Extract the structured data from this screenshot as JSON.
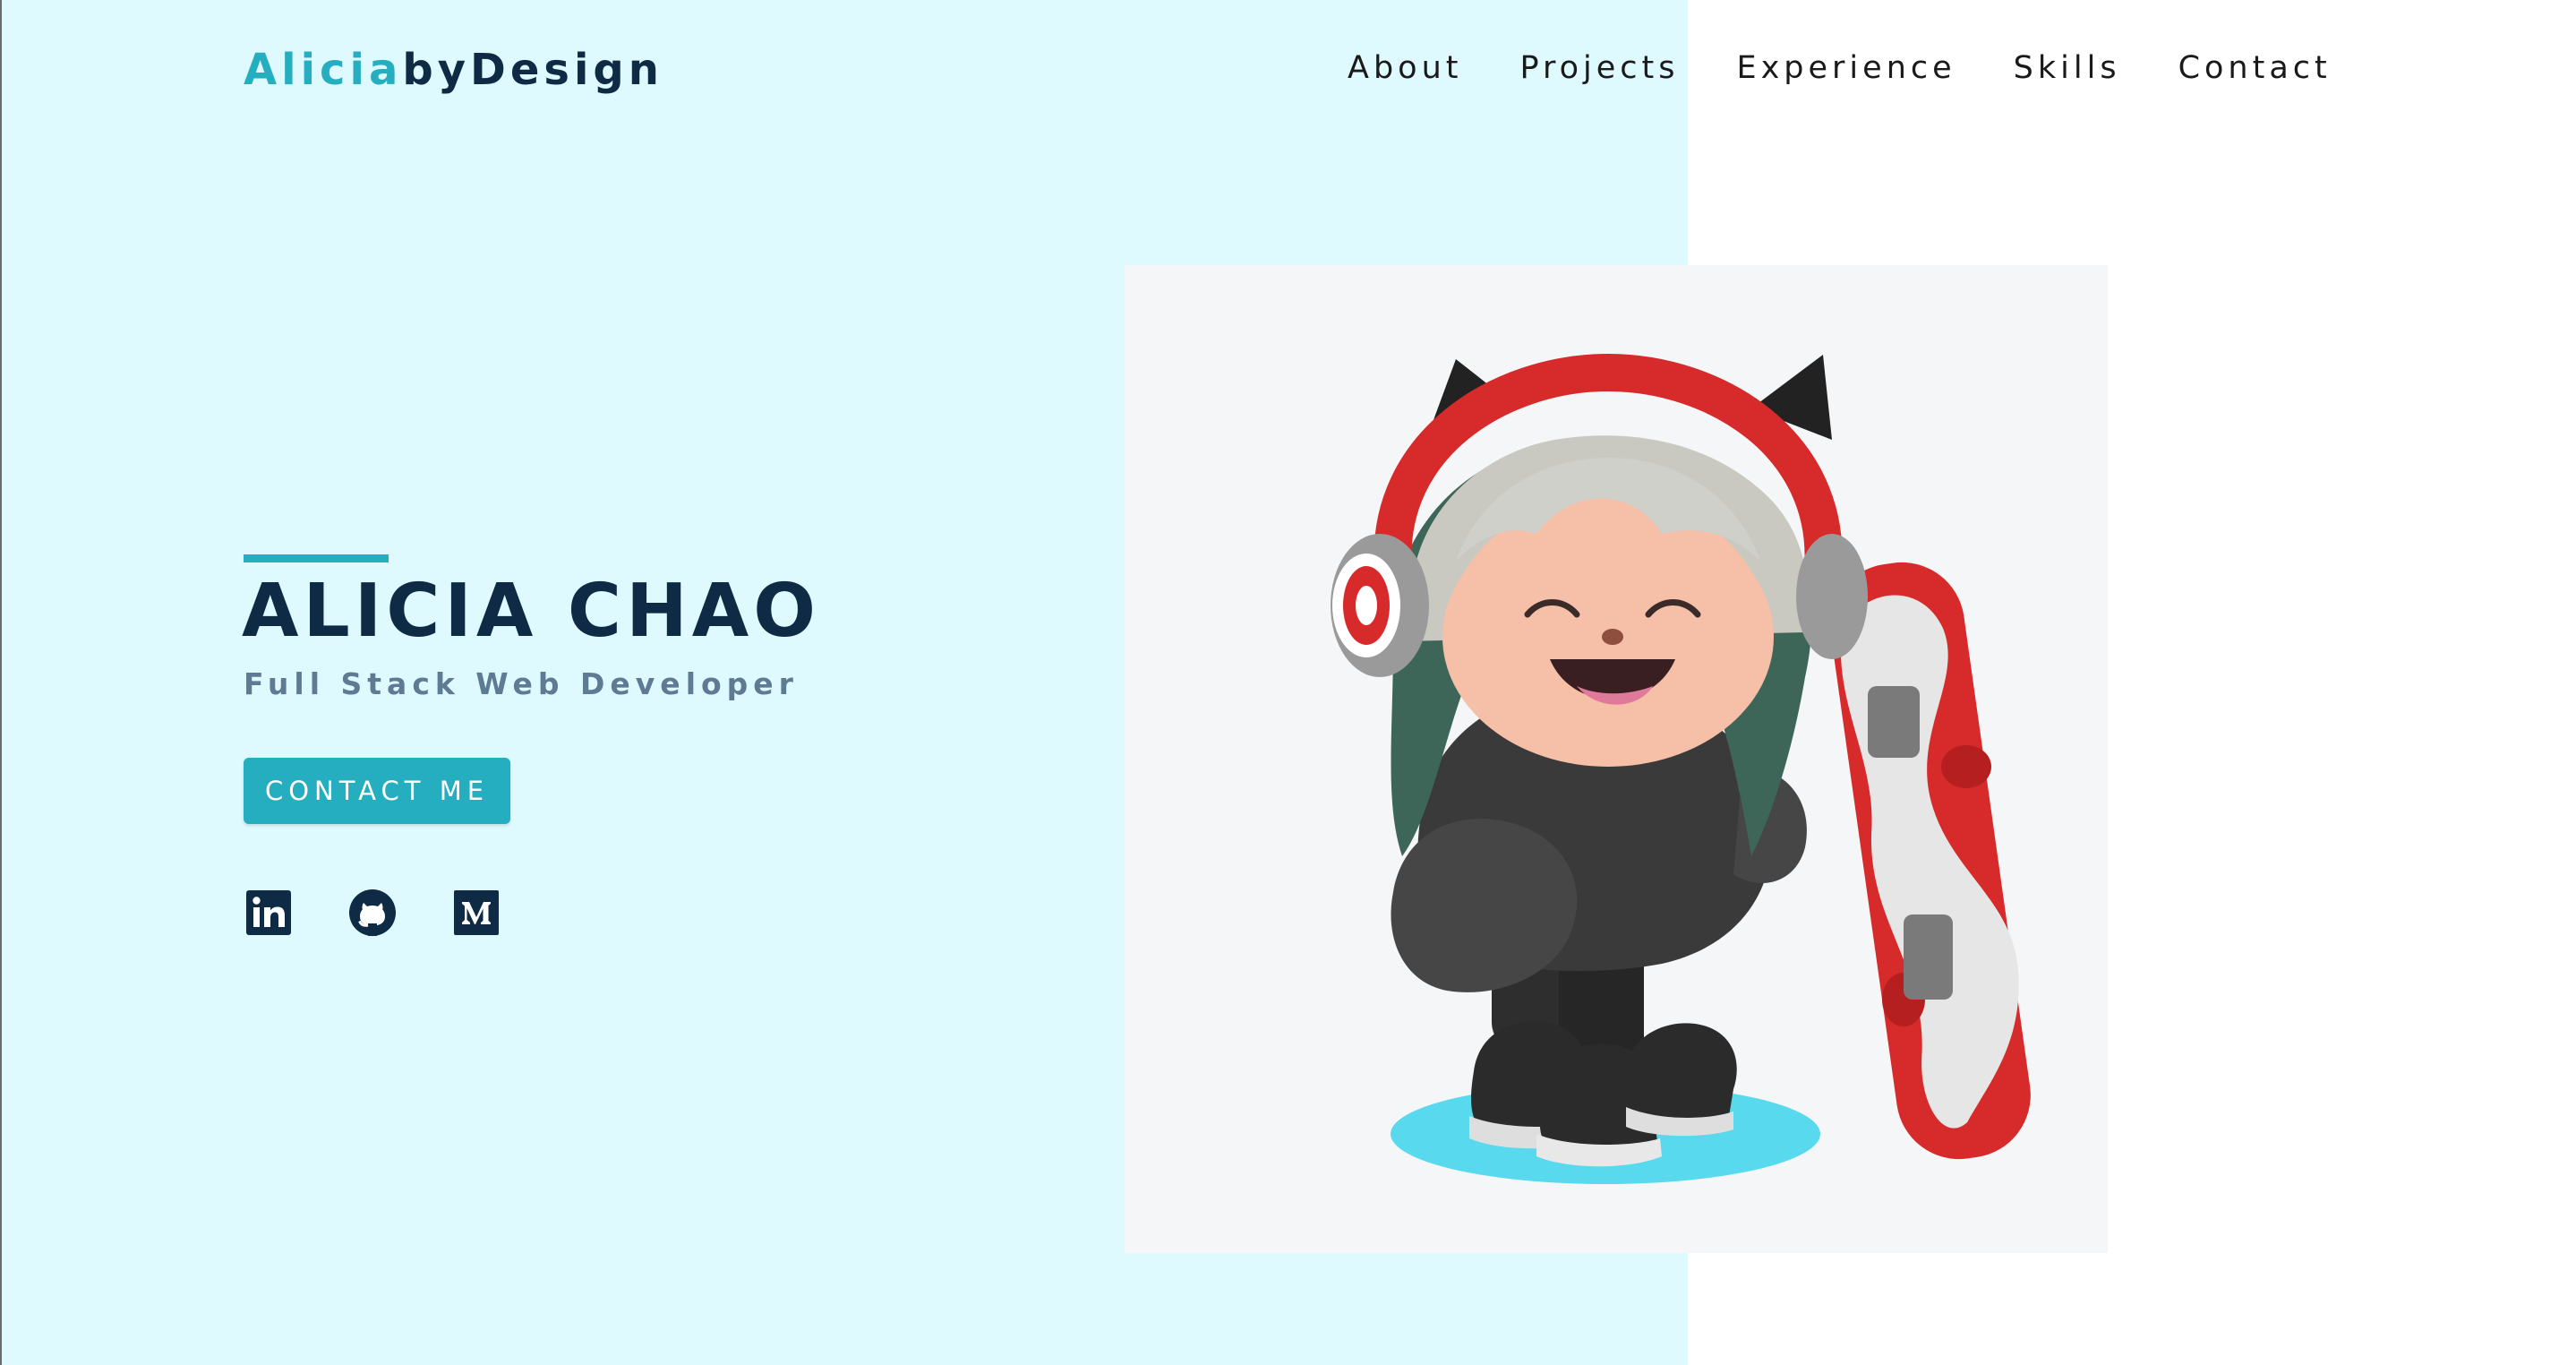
{
  "header": {
    "logo_part1": "Alicia",
    "logo_part2": "byDesign",
    "nav": [
      {
        "label": "About"
      },
      {
        "label": "Projects"
      },
      {
        "label": "Experience"
      },
      {
        "label": "Skills"
      },
      {
        "label": "Contact"
      }
    ]
  },
  "hero": {
    "name": "ALICIA CHAO",
    "subtitle": "Full Stack Web Developer",
    "cta_label": "CONTACT ME",
    "socials": [
      {
        "icon": "linkedin-icon"
      },
      {
        "icon": "github-icon"
      },
      {
        "icon": "medium-icon"
      }
    ],
    "illustration": "octocat-snowboarder-illustration"
  },
  "colors": {
    "accent": "#25aebf",
    "navy": "#0f2a45",
    "subtitle_gray": "#5f7a93",
    "left_panel_bg": "#defafe",
    "illustration_card_bg": "#f5f6f8"
  }
}
